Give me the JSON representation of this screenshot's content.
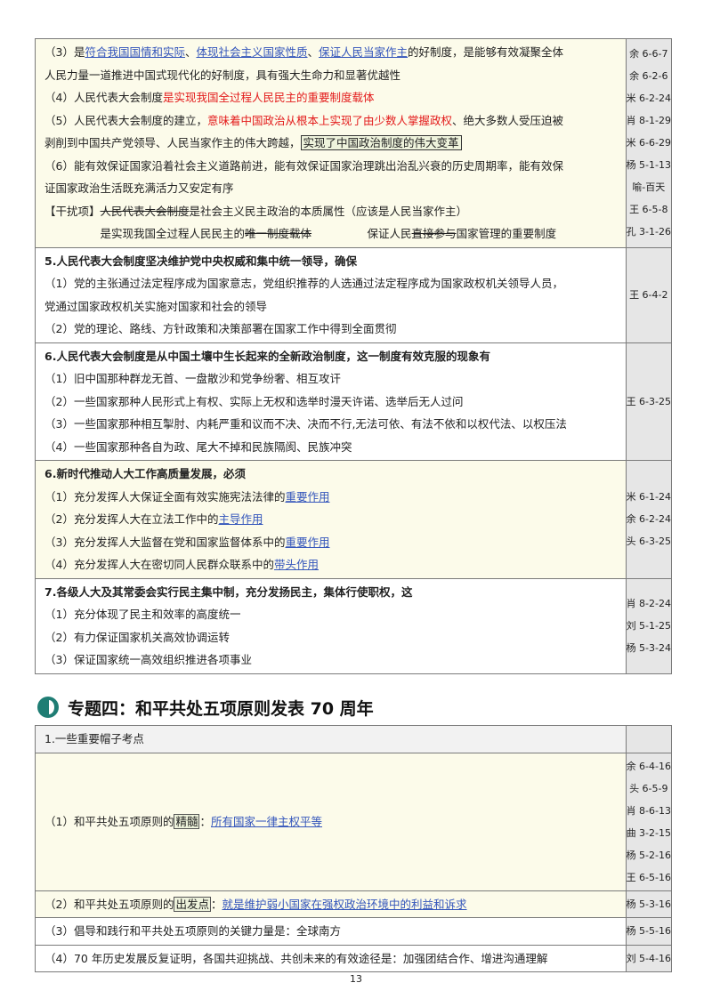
{
  "block1": {
    "lines": [
      {
        "id": "l1",
        "parts": [
          {
            "t": "（3）是"
          },
          {
            "t": "符合我国国情和实际",
            "c": "blue"
          },
          {
            "t": "、"
          },
          {
            "t": "体现社会主义国家性质",
            "c": "blue"
          },
          {
            "t": "、"
          },
          {
            "t": "保证人民当家作主",
            "c": "blue"
          },
          {
            "t": "的好制度，是能够有效凝聚全体"
          }
        ]
      },
      {
        "id": "l2",
        "parts": [
          {
            "t": "人民力量一道推进中国式现代化的好制度，具有强大生命力和显著优越性"
          }
        ]
      },
      {
        "id": "l3",
        "parts": [
          {
            "t": "（4）人民代表大会制度"
          },
          {
            "t": "是实现我国全过程人民民主的重要制度载体",
            "c": "red"
          }
        ]
      },
      {
        "id": "l4",
        "parts": [
          {
            "t": "（5）人民代表大会制度的建立，"
          },
          {
            "t": "意味着中国政治从根本上实现了由少数人掌握政权",
            "c": "red"
          },
          {
            "t": "、绝大多数人受压迫被"
          }
        ]
      },
      {
        "id": "l5",
        "parts": [
          {
            "t": "剥削到中国共产党领导、人民当家作主的伟大跨越，"
          },
          {
            "t": "实现了中国政治制度的伟大变革",
            "c": "box"
          }
        ]
      },
      {
        "id": "l6",
        "parts": [
          {
            "t": "（6）能有效保证国家沿着社会主义道路前进，能有效保证国家治理跳出治乱兴衰的历史周期率，能有效保"
          }
        ]
      },
      {
        "id": "l7",
        "parts": [
          {
            "t": "证国家政治生活既充满活力又安定有序"
          }
        ]
      },
      {
        "id": "l8",
        "parts": [
          {
            "t": "【干扰项】"
          },
          {
            "t": "人民代表大会制度",
            "c": "strike"
          },
          {
            "t": "是社会主义民主政治的本质属性（应该是人民当家作主）"
          }
        ]
      },
      {
        "id": "l9",
        "parts": [
          {
            "t": "　　　　　是实现我国全过程人民民主的"
          },
          {
            "t": "唯一制度载体",
            "c": "strike"
          },
          {
            "t": "　　　　　保证人民"
          },
          {
            "t": "直接参与",
            "c": "strike"
          },
          {
            "t": "国家管理的重要制度"
          }
        ]
      }
    ],
    "refs": [
      "余 6-6-7",
      "余 6-2-6",
      "米 6-2-24",
      "肖 8-1-29",
      "米 6-6-29",
      "杨 5-1-13",
      "喻-百天",
      "王 6-5-8",
      "孔 3-1-26"
    ]
  },
  "block5": {
    "title": "5.人民代表大会制度坚决维护党中央权威和集中统一领导，确保",
    "lines": [
      "（1）党的主张通过法定程序成为国家意志，党组织推荐的人选通过法定程序成为国家政权机关领导人员，",
      "党通过国家政权机关实施对国家和社会的领导",
      "（2）党的理论、路线、方针政策和决策部署在国家工作中得到全面贯彻"
    ],
    "refs": [
      "王 6-4-2"
    ]
  },
  "block6": {
    "title": "6.人民代表大会制度是从中国土壤中生长起来的全新政治制度，这一制度有效克服的现象有",
    "lines": [
      "（1）旧中国那种群龙无首、一盘散沙和党争纷奢、相互攻讦",
      "（2）一些国家那种人民形式上有权、实际上无权和选举时漫天许诺、选举后无人过问",
      "（3）一些国家那种相互掣肘、内耗严重和议而不决、决而不行,无法可依、有法不依和以权代法、以权压法",
      "（4）一些国家那种各自为政、尾大不掉和民族隔阂、民族冲突"
    ],
    "refs": [
      "王 6-3-25"
    ]
  },
  "block7": {
    "title": "6.新时代推动人大工作高质量发展，必须",
    "lines": [
      {
        "pre": "（1）充分发挥人大保证全面有效实施宪法法律的",
        "link": "重要作用"
      },
      {
        "pre": "（2）充分发挥人大在立法工作中的",
        "link": "主导作用"
      },
      {
        "pre": "（3）充分发挥人大监督在党和国家监督体系中的",
        "link": "重要作用"
      },
      {
        "pre": "（4）充分发挥人大在密切同人民群众联系中的",
        "link": "带头作用"
      }
    ],
    "refs": [
      "米 6-1-24",
      "余 6-2-24",
      "头 6-3-25"
    ]
  },
  "block8": {
    "title": "7.各级人大及其常委会实行民主集中制，充分发扬民主，集体行使职权，这",
    "lines": [
      "（1）充分体现了民主和效率的高度统一",
      "（2）有力保证国家机关高效协调运转",
      "（3）保证国家统一高效组织推进各项事业"
    ],
    "refs": [
      "肖 8-2-24",
      "刘 5-1-25",
      "杨 5-3-24"
    ]
  },
  "section": {
    "title": "专题四：和平共处五项原则发表 70 周年"
  },
  "table2": {
    "header": "1.一些重要帽子考点",
    "row1": {
      "pre": "（1）和平共处五项原则的",
      "key": "精髓",
      "colon": "：",
      "link": "所有国家一律主权平等",
      "refs": [
        "余 6-4-16",
        "头 6-5-9",
        "肖 8-6-13",
        "曲 3-2-15",
        "杨 5-2-16",
        "王 6-5-16"
      ]
    },
    "row2": {
      "pre": "（2）和平共处五项原则的",
      "key": "出发点",
      "colon": "：",
      "link": "就是维护弱小国家在强权政治环境中的利益和诉求",
      "refs": [
        "杨 5-3-16"
      ]
    },
    "row3": {
      "text": "（3）倡导和践行和平共处五项原则的关键力量是：全球南方",
      "refs": [
        "杨 5-5-16"
      ]
    },
    "row4": {
      "text": "（4）70 年历史发展反复证明，各国共迎挑战、共创未来的有效途径是：加强团结合作、增进沟通理解",
      "refs": [
        "刘 5-4-16"
      ]
    }
  },
  "page_number": "13"
}
